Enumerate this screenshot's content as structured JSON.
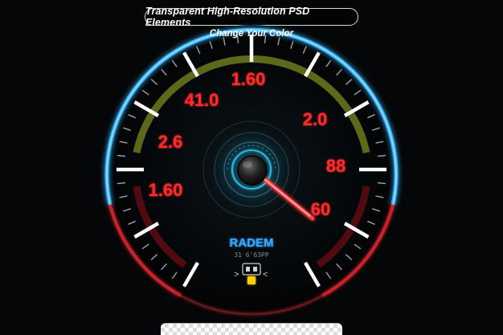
{
  "header": {
    "banner_text": "Transparent High-Resolution PSD Elements",
    "subtitle": "Change Your Color"
  },
  "gauge": {
    "scale_labels": [
      "1.60",
      "41.0",
      "2.0",
      "2.6",
      "88",
      "1.60",
      "60"
    ],
    "brand": "RADEM",
    "sub_brand": "31 6'63PP",
    "colors": {
      "background": "#050607",
      "blue_ring": "#39b5ff",
      "red_ring": "#c8202a",
      "olive_band": "#6d7a1c",
      "red_band": "#5a0c12",
      "labels": "#ff2a2a",
      "needle": "#ff3b3b",
      "brand_text": "#35a9ff",
      "indicator": "#ffcc00"
    },
    "icons": [
      "engine-indicator-icon",
      "center-hub-icon",
      "needle-icon"
    ]
  }
}
